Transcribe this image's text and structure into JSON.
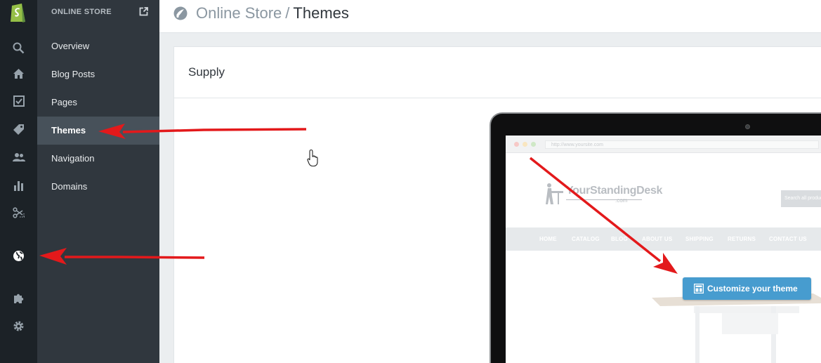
{
  "sidebar": {
    "header": "ONLINE STORE",
    "items": [
      {
        "label": "Overview",
        "active": false
      },
      {
        "label": "Blog Posts",
        "active": false
      },
      {
        "label": "Pages",
        "active": false
      },
      {
        "label": "Themes",
        "active": true
      },
      {
        "label": "Navigation",
        "active": false
      },
      {
        "label": "Domains",
        "active": false
      }
    ]
  },
  "rail": {
    "icons": [
      "shopify-logo-icon",
      "search-icon",
      "home-icon",
      "orders-icon",
      "products-icon",
      "customers-icon",
      "reports-icon",
      "discounts-icon",
      "online-store-globe-icon",
      "apps-icon",
      "settings-icon"
    ]
  },
  "header": {
    "section": "Online Store",
    "separator": "/",
    "current": "Themes"
  },
  "theme": {
    "name": "Supply",
    "customize_label": "Customize your theme"
  },
  "preview": {
    "url": "http://www.yoursite.com",
    "logo_text": "YourStandingDesk",
    "logo_suffix": ".com",
    "search_placeholder": "Search all products",
    "nav": [
      "HOME",
      "CATALOG",
      "BLOG",
      "ABOUT US",
      "SHIPPING",
      "RETURNS",
      "CONTACT US"
    ]
  },
  "colors": {
    "rail_bg": "#1c2227",
    "sidebar_bg": "#30373e",
    "active_item_bg": "#47515a",
    "accent_button": "#479ccf",
    "annotation_arrow": "#e3191b"
  }
}
